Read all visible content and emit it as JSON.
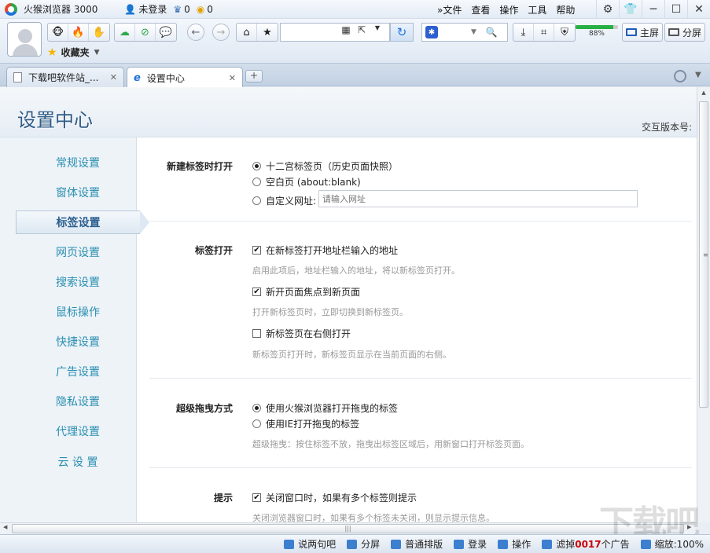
{
  "titlebar": {
    "app_title": "火猴浏览器 3000",
    "login": "未登录",
    "crown_count": "0",
    "coin_count": "0",
    "menus": [
      "»文件",
      "查看",
      "操作",
      "工具",
      "帮助"
    ]
  },
  "toolbar": {
    "favorites": "收藏夹",
    "memory_fraction": 0.88,
    "memory_label": "88%",
    "main_screen": "主屏",
    "split_screen": "分屏"
  },
  "tabs": [
    {
      "label": "下载吧软件站_...",
      "active": false
    },
    {
      "label": "设置中心",
      "active": true
    }
  ],
  "page": {
    "title": "设置中心",
    "version_label": "交互版本号:"
  },
  "sidebar": {
    "items": [
      "常规设置",
      "窗体设置",
      "标签设置",
      "网页设置",
      "搜索设置",
      "鼠标操作",
      "快捷设置",
      "广告设置",
      "隐私设置",
      "代理设置",
      "云 设 置"
    ],
    "active_index": 2
  },
  "sections": {
    "new_tab": {
      "label": "新建标签时打开",
      "options": [
        "十二宫标签页（历史页面快照）",
        "空白页 (about:blank)",
        "自定义网址:"
      ],
      "selected": 0,
      "url_placeholder": "请输入网址"
    },
    "tab_open": {
      "label": "标签打开",
      "items": [
        {
          "text": "在新标签打开地址栏输入的地址",
          "checked": true,
          "hint": "启用此项后，地址栏输入的地址，将以新标签页打开。"
        },
        {
          "text": "新开页面焦点到新页面",
          "checked": true,
          "hint": "打开新标签页时，立即切换到新标签页。"
        },
        {
          "text": "新标签页在右侧打开",
          "checked": false,
          "hint": "新标签页打开时，新标签页显示在当前页面的右侧。"
        }
      ]
    },
    "super_drag": {
      "label": "超级拖曳方式",
      "options": [
        "使用火猴浏览器打开拖曳的标签",
        "使用IE打开拖曳的标签"
      ],
      "selected": 0,
      "hint": "超级拖曳：按住标签不放，拖曳出标签区域后，用新窗口打开标签页面。"
    },
    "tips": {
      "label": "提示",
      "item": "关闭窗口时，如果有多个标签则提示",
      "checked": true,
      "hint": "关闭浏览器窗口时，如果有多个标签未关闭，则显示提示信息。"
    }
  },
  "statusbar": {
    "chat": "说两句吧",
    "split": "分屏",
    "layout": "普通排版",
    "login": "登录",
    "operate": "操作",
    "filter_prefix": "滤掉",
    "filter_count": "0017",
    "filter_suffix": "个广告",
    "zoom": "缩放:100%"
  },
  "watermark": "下载吧"
}
